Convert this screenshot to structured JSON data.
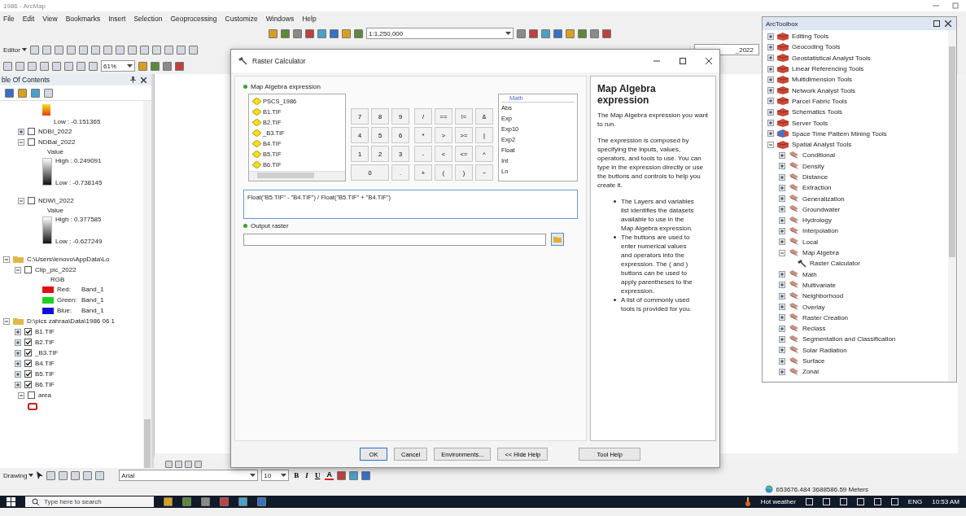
{
  "window": {
    "title": "1986 - ArcMap"
  },
  "menu": [
    "File",
    "Edit",
    "View",
    "Bookmarks",
    "Insert",
    "Selection",
    "Geoprocessing",
    "Customize",
    "Windows",
    "Help"
  ],
  "toolbar": {
    "scale": "1:1,250,000",
    "editor": "Editor",
    "zoom": "61%",
    "layer_field": "_2022"
  },
  "toc": {
    "title": "ble Of Contents",
    "groups": [
      {
        "kind": "ramp_tail",
        "low": "Low : -0.151365"
      },
      {
        "kind": "layer",
        "name": "NDBI_2022",
        "expanded": false,
        "checked": false
      },
      {
        "kind": "layer",
        "name": "NDBal_2022",
        "expanded": true,
        "checked": false,
        "legend": {
          "title": "Value",
          "high": "High : 0.249091",
          "low": "Low : -0.738145"
        }
      },
      {
        "kind": "layer",
        "name": "NDWI_2022",
        "expanded": true,
        "checked": false,
        "legend": {
          "title": "Value",
          "high": "High : 0.377585",
          "low": "Low : -0.627249"
        }
      },
      {
        "kind": "folder",
        "name": "C:\\Users\\lenovo\\AppData\\Lo",
        "expanded": true,
        "children": [
          {
            "kind": "layer",
            "name": "Clip_pic_2022",
            "expanded": true,
            "checked": false,
            "rgb": {
              "title": "RGB",
              "bands": [
                {
                  "label": "Red:",
                  "band": "Band_1",
                  "color": "#e01010"
                },
                {
                  "label": "Green:",
                  "band": "Band_1",
                  "color": "#20d020"
                },
                {
                  "label": "Blue:",
                  "band": "Band_1",
                  "color": "#1010d8"
                }
              ]
            }
          }
        ]
      },
      {
        "kind": "folder",
        "name": "D:\\pics zahraa\\Data\\1986 06 1",
        "expanded": true,
        "children": [
          {
            "kind": "layer",
            "name": "B1.TIF",
            "expanded": false,
            "checked": true
          },
          {
            "kind": "layer",
            "name": "B2.TIF",
            "expanded": false,
            "checked": true
          },
          {
            "kind": "layer",
            "name": "_B3.TIF",
            "expanded": false,
            "checked": true
          },
          {
            "kind": "layer",
            "name": "B4.TIF",
            "expanded": false,
            "checked": true
          },
          {
            "kind": "layer",
            "name": "B5.TIF",
            "expanded": false,
            "checked": true
          },
          {
            "kind": "layer",
            "name": "B6.TIF",
            "expanded": false,
            "checked": true
          }
        ]
      },
      {
        "kind": "feature",
        "name": "area",
        "expanded": true,
        "checked": false
      }
    ]
  },
  "dialog": {
    "title": "Raster Calculator",
    "expression_label": "Map Algebra expression",
    "layers": [
      "PSCS_1986",
      "B1.TIF",
      "B2.TIF",
      "_B3.TIF",
      "B4.TIF",
      "B5.TIF",
      "B6.TIF"
    ],
    "number_keys": [
      "7",
      "8",
      "9",
      "4",
      "5",
      "6",
      "1",
      "2",
      "3",
      "0",
      "."
    ],
    "operator_keys": [
      "/",
      "==",
      "!=",
      "&",
      "*",
      ">",
      ">=",
      "|",
      "-",
      "<",
      "<=",
      "^",
      "+",
      "(",
      ")",
      "~"
    ],
    "math_header": "Math",
    "functions": [
      "Abs",
      "Exp",
      "Exp10",
      "Exp2",
      "Float",
      "Int",
      "Ln"
    ],
    "expression": "Float(\"B5.TIF\" - \"B4.TIF\") / Float(\"B5.TIF\" + \"B4.TIF\")",
    "output_label": "Output raster",
    "buttons": [
      "OK",
      "Cancel",
      "Environments...",
      "<< Hide Help"
    ],
    "tool_help": "Tool Help",
    "help": {
      "title": "Map Algebra expression",
      "paragraphs": [
        "The Map Algebra expression you want to run.",
        "The expression is composed by specifying the inputs, values, operators, and tools to use. You can type in the expression directly or use the buttons and controls to help you create it."
      ],
      "bullets": [
        "The Layers and variables list identifies the datasets available to use in the Map Algebra expression.",
        "The buttons are used to enter numerical values and operators into the expression. The ( and ) buttons can be used to apply parentheses to the expression.",
        "A list of commonly used tools is provided for you."
      ]
    }
  },
  "toolbox": {
    "title": "ArcToolbox",
    "items": [
      {
        "kind": "toolbox",
        "name": "Editing Tools",
        "expanded": false
      },
      {
        "kind": "toolbox",
        "name": "Geocoding Tools",
        "expanded": false
      },
      {
        "kind": "toolbox",
        "name": "Geostatistical Analyst Tools",
        "expanded": false
      },
      {
        "kind": "toolbox",
        "name": "Linear Referencing Tools",
        "expanded": false
      },
      {
        "kind": "toolbox",
        "name": "Multidimension Tools",
        "expanded": false
      },
      {
        "kind": "toolbox",
        "name": "Network Analyst Tools",
        "expanded": false
      },
      {
        "kind": "toolbox",
        "name": "Parcel Fabric Tools",
        "expanded": false
      },
      {
        "kind": "toolbox",
        "name": "Schematics Tools",
        "expanded": false
      },
      {
        "kind": "toolbox",
        "name": "Server Tools",
        "expanded": false
      },
      {
        "kind": "globe_toolbox",
        "name": "Space Time Pattern Mining Tools",
        "expanded": false
      },
      {
        "kind": "toolbox",
        "name": "Spatial Analyst Tools",
        "expanded": true,
        "children": [
          {
            "kind": "toolset",
            "name": "Conditional",
            "expanded": false
          },
          {
            "kind": "toolset",
            "name": "Density",
            "expanded": false
          },
          {
            "kind": "toolset",
            "name": "Distance",
            "expanded": false
          },
          {
            "kind": "toolset",
            "name": "Extraction",
            "expanded": false
          },
          {
            "kind": "toolset",
            "name": "Generalization",
            "expanded": false
          },
          {
            "kind": "toolset",
            "name": "Groundwater",
            "expanded": false
          },
          {
            "kind": "toolset",
            "name": "Hydrology",
            "expanded": false
          },
          {
            "kind": "toolset",
            "name": "Interpolation",
            "expanded": false
          },
          {
            "kind": "toolset",
            "name": "Local",
            "expanded": false
          },
          {
            "kind": "toolset",
            "name": "Map Algebra",
            "expanded": true,
            "children": [
              {
                "kind": "tool",
                "name": "Raster Calculator"
              }
            ]
          },
          {
            "kind": "toolset",
            "name": "Math",
            "expanded": false
          },
          {
            "kind": "toolset",
            "name": "Multivariate",
            "expanded": false
          },
          {
            "kind": "toolset",
            "name": "Neighborhood",
            "expanded": false
          },
          {
            "kind": "toolset",
            "name": "Overlay",
            "expanded": false
          },
          {
            "kind": "toolset",
            "name": "Raster Creation",
            "expanded": false
          },
          {
            "kind": "toolset",
            "name": "Reclass",
            "expanded": false
          },
          {
            "kind": "toolset",
            "name": "Segmentation and Classification",
            "expanded": false
          },
          {
            "kind": "toolset",
            "name": "Solar Radiation",
            "expanded": false
          },
          {
            "kind": "toolset",
            "name": "Surface",
            "expanded": false
          },
          {
            "kind": "toolset",
            "name": "Zonal",
            "expanded": false
          }
        ]
      }
    ]
  },
  "drawing": {
    "label": "Drawing",
    "font": "Arial",
    "size": "10",
    "format_buttons": [
      "B",
      "I",
      "U"
    ],
    "font_color": "A"
  },
  "status": {
    "coordinates": "653676.484  3688586.59 Meters"
  },
  "taskbar": {
    "search_placeholder": "Type here to search",
    "weather": "Hot weather",
    "language": "ENG",
    "time": "10:53 AM"
  }
}
